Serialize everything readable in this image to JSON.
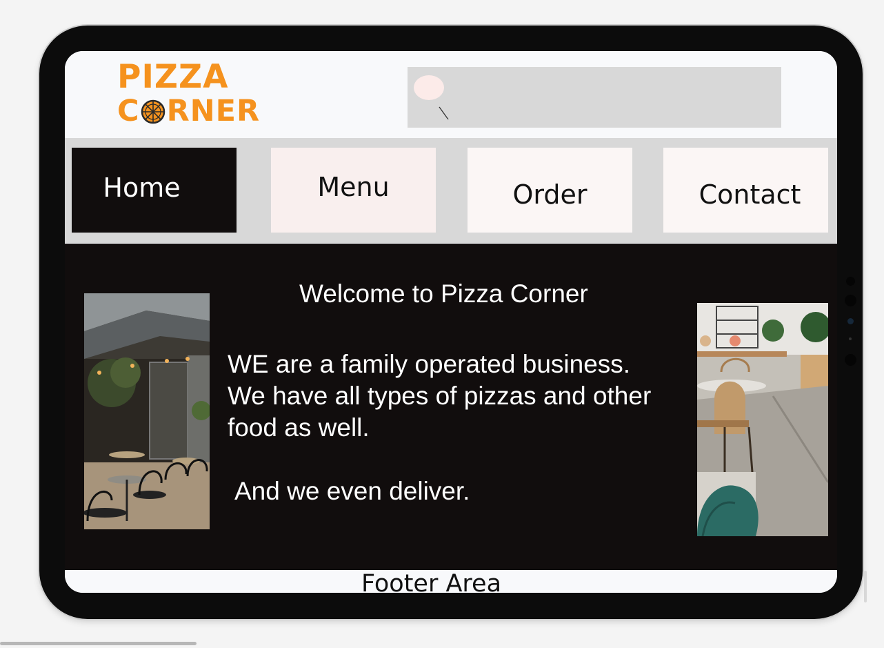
{
  "brand": {
    "line1": "PIZZA",
    "line2_before_icon": "C",
    "line2_after_icon": "RNER",
    "color": "#f5921e"
  },
  "search": {
    "icon": "search-icon",
    "background": "#d8d8d8"
  },
  "nav": {
    "items": [
      {
        "label": "Home",
        "background": "#110d0d",
        "color": "#ffffff"
      },
      {
        "label": "Menu",
        "background": "#f9efee",
        "color": "#111111"
      },
      {
        "label": "Order",
        "background": "#fbf6f5",
        "color": "#111111"
      },
      {
        "label": "Contact",
        "background": "#fbf6f5",
        "color": "#111111"
      }
    ]
  },
  "hero": {
    "title": "Welcome to Pizza Corner",
    "body": "WE are a family operated business.\nWe have all types of pizzas and other\nfood as well.",
    "tagline": "And we even deliver.",
    "background": "#110d0d",
    "left_photo": "restaurant-terrace-photo",
    "right_photo": "cafe-interior-photo"
  },
  "footer": {
    "label": "Footer Area"
  }
}
